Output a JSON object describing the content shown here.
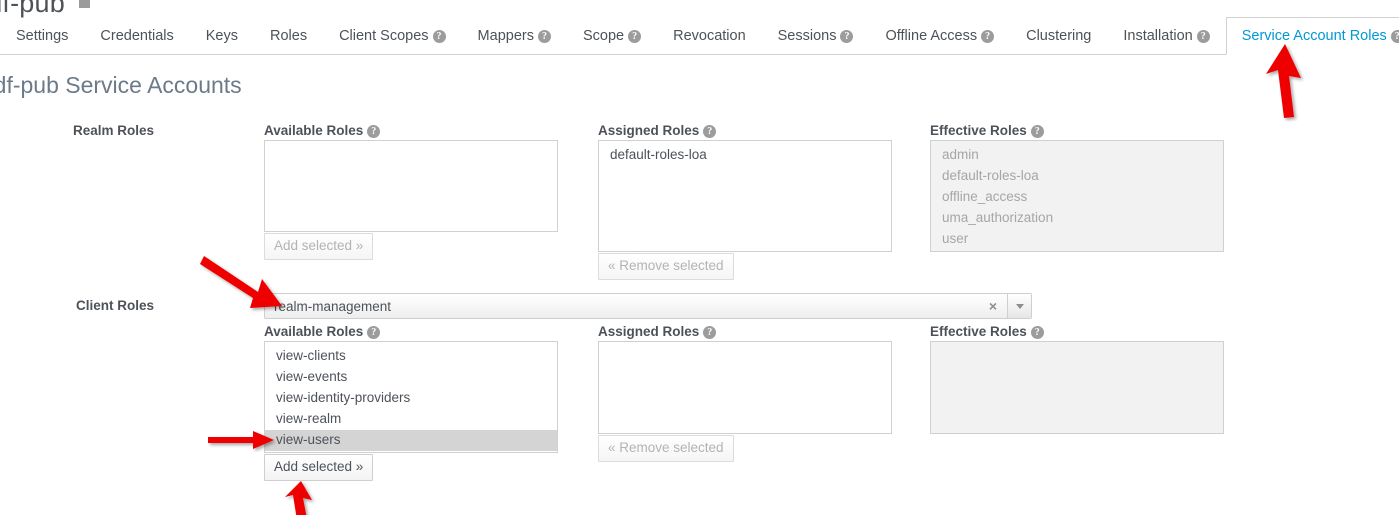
{
  "window": {
    "client_heading": "rdf-pub",
    "page_title": "rdf-pub Service Accounts"
  },
  "tabs": [
    {
      "label": "Settings",
      "help": false,
      "active": false
    },
    {
      "label": "Credentials",
      "help": false,
      "active": false
    },
    {
      "label": "Keys",
      "help": false,
      "active": false
    },
    {
      "label": "Roles",
      "help": false,
      "active": false
    },
    {
      "label": "Client Scopes",
      "help": true,
      "active": false
    },
    {
      "label": "Mappers",
      "help": true,
      "active": false
    },
    {
      "label": "Scope",
      "help": true,
      "active": false
    },
    {
      "label": "Revocation",
      "help": false,
      "active": false
    },
    {
      "label": "Sessions",
      "help": true,
      "active": false
    },
    {
      "label": "Offline Access",
      "help": true,
      "active": false
    },
    {
      "label": "Clustering",
      "help": false,
      "active": false
    },
    {
      "label": "Installation",
      "help": true,
      "active": false
    },
    {
      "label": "Service Account Roles",
      "help": true,
      "active": true
    }
  ],
  "realm_roles": {
    "row_label": "Realm Roles",
    "available": {
      "label": "Available Roles",
      "items": [],
      "button": "Add selected »",
      "button_disabled": true
    },
    "assigned": {
      "label": "Assigned Roles",
      "items": [
        "default-roles-loa"
      ],
      "button": "« Remove selected",
      "button_disabled": true
    },
    "effective": {
      "label": "Effective Roles",
      "items": [
        "admin",
        "default-roles-loa",
        "offline_access",
        "uma_authorization",
        "user"
      ]
    }
  },
  "client_roles": {
    "row_label": "Client Roles",
    "selected_client": "realm-management",
    "clear_icon": "×",
    "available": {
      "label": "Available Roles",
      "items": [
        "view-clients",
        "view-events",
        "view-identity-providers",
        "view-realm",
        "view-users"
      ],
      "selected_item": "view-users",
      "button": "Add selected »",
      "button_disabled": false
    },
    "assigned": {
      "label": "Assigned Roles",
      "items": [],
      "button": "« Remove selected",
      "button_disabled": true
    },
    "effective": {
      "label": "Effective Roles",
      "items": []
    }
  },
  "annotations": {
    "arrow_color": "#ee0000",
    "arrows": [
      {
        "name": "arrow-to-service-account-roles-tab",
        "points_to": "Service Account Roles"
      },
      {
        "name": "arrow-to-client-roles-select",
        "points_to": "realm-management"
      },
      {
        "name": "arrow-to-view-users-option",
        "points_to": "view-users"
      },
      {
        "name": "arrow-to-add-selected-button",
        "points_to": "Add selected »"
      }
    ]
  }
}
